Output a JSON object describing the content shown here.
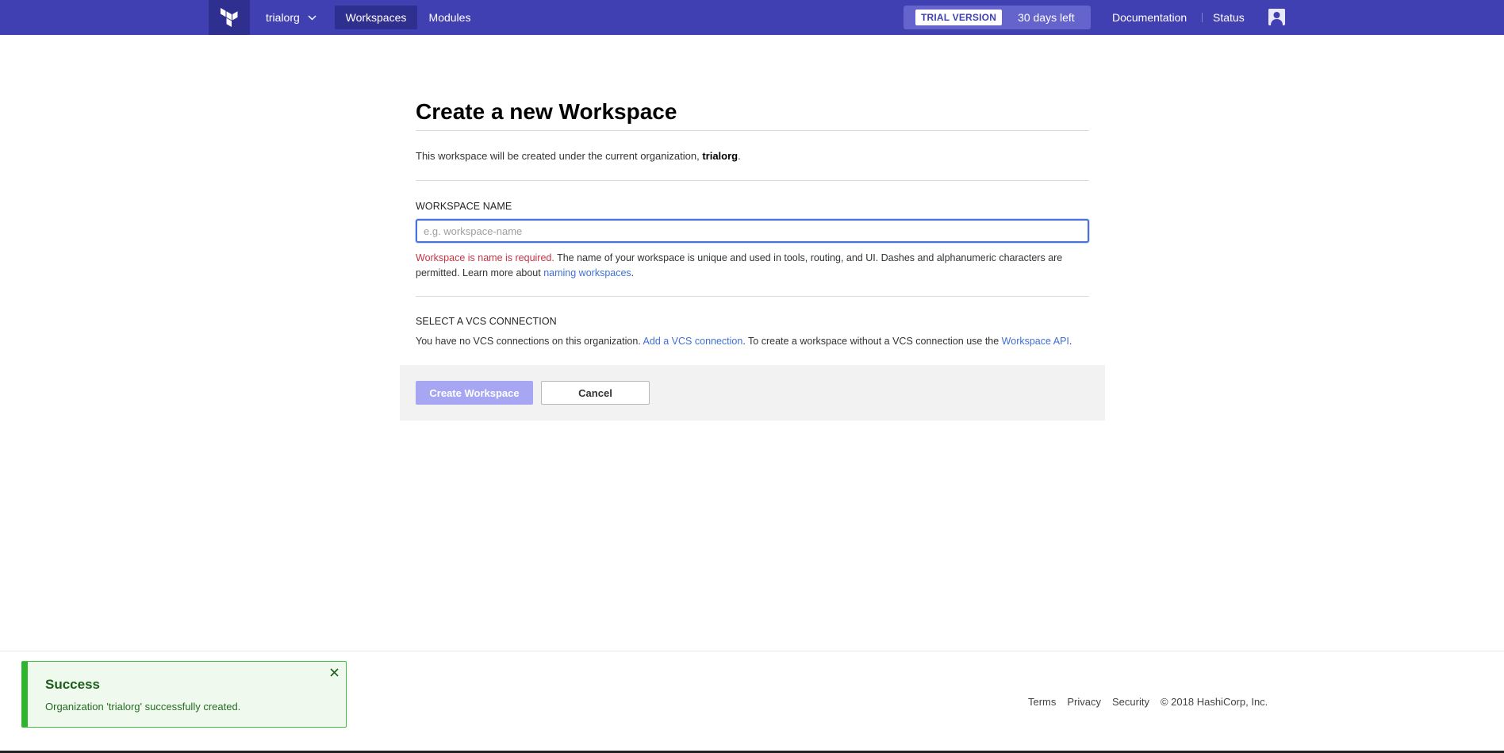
{
  "nav": {
    "org_name": "trialorg",
    "tabs": [
      {
        "label": "Workspaces",
        "active": true
      },
      {
        "label": "Modules",
        "active": false
      }
    ],
    "trial_badge": "TRIAL VERSION",
    "trial_days": "30 days left",
    "documentation": "Documentation",
    "status": "Status"
  },
  "page": {
    "title": "Create a new Workspace",
    "intro_prefix": "This workspace will be created under the current organization,",
    "intro_org": "trialorg",
    "intro_suffix": "."
  },
  "workspace_name": {
    "label": "WORKSPACE NAME",
    "placeholder": "e.g. workspace-name",
    "value": "",
    "error": "Workspace is name is required.",
    "help": " The name of your workspace is unique and used in tools, routing, and UI. Dashes and alphanumeric characters are permitted. Learn more about ",
    "help_link": "naming workspaces",
    "help_end": "."
  },
  "vcs": {
    "label": "SELECT A VCS CONNECTION",
    "text_prefix": "You have no VCS connections on this organization. ",
    "add_link": "Add a VCS connection",
    "text_mid": ". To create a workspace without a VCS connection use the ",
    "api_link": "Workspace API",
    "text_end": "."
  },
  "actions": {
    "create_label": "Create Workspace",
    "cancel_label": "Cancel"
  },
  "footer": {
    "terms": "Terms",
    "privacy": "Privacy",
    "security": "Security",
    "copyright": "© 2018 HashiCorp, Inc."
  },
  "toast": {
    "title": "Success",
    "message": "Organization 'trialorg' successfully created."
  },
  "colors": {
    "nav_bg": "#4040b2",
    "nav_active": "#2f2f8f",
    "link": "#3f6fd6",
    "error": "#c73445",
    "success_border": "#2db52d",
    "primary_disabled": "#a6a6f2"
  },
  "icons": {
    "logo": "terraform-logo-icon",
    "org_dropdown": "chevron-down-icon",
    "avatar": "user-avatar-icon",
    "toast_close": "close-icon"
  }
}
